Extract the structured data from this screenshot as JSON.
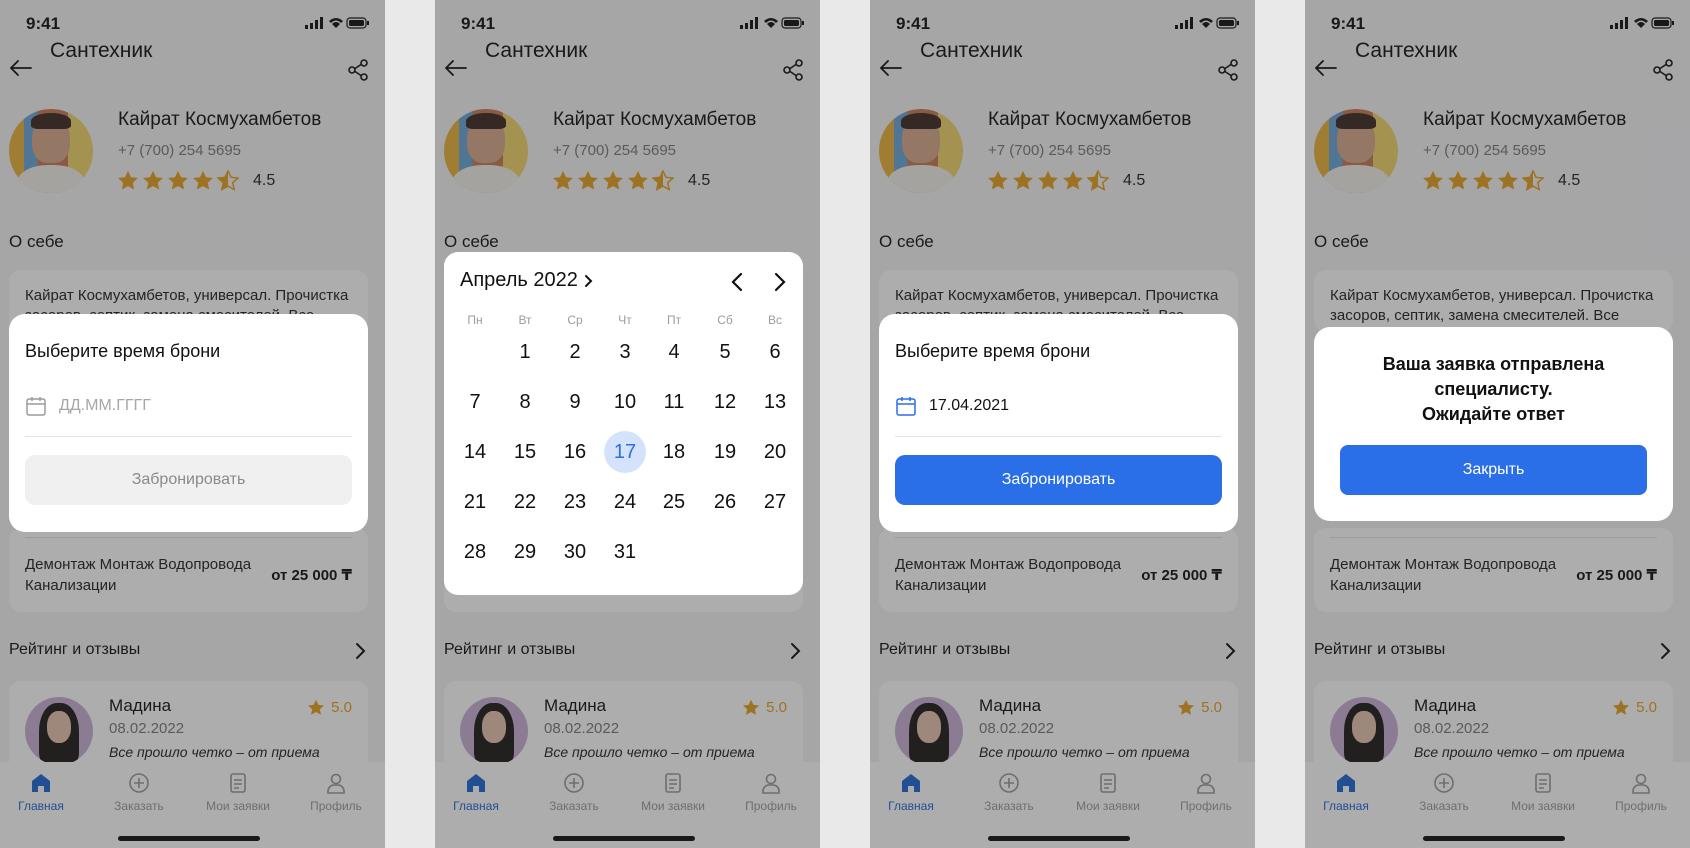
{
  "status_time": "9:41",
  "title": "Сантехник",
  "profile": {
    "name": "Кайрат Космухамбетов",
    "phone": "+7 (700) 254 5695",
    "rating": "4.5"
  },
  "about": {
    "heading": "О себе",
    "text": "Кайрат Космухамбетов, универсал. Прочистка засоров, септик, замена смесителей. Все"
  },
  "service": {
    "name": "Демонтаж Монтаж Водопровода Канализации",
    "price": "от 25 000 ₸"
  },
  "rating_heading": "Рейтинг и отзывы",
  "review": {
    "name": "Мадина",
    "date": "08.02.2022",
    "score": "5.0",
    "text": "Все прошло четко – от приема"
  },
  "tabs": [
    {
      "label": "Главная",
      "icon": "home-icon"
    },
    {
      "label": "Заказать",
      "icon": "plus-circle-icon"
    },
    {
      "label": "Мои заявки",
      "icon": "document-icon"
    },
    {
      "label": "Профиль",
      "icon": "user-icon"
    }
  ],
  "booking": {
    "title": "Выберите время брони",
    "placeholder": "ДД.ММ.ГГГГ",
    "filled_value": "17.04.2021",
    "button": "Забронировать"
  },
  "calendar": {
    "month": "Апрель 2022",
    "weekdays": [
      "Пн",
      "Вт",
      "Ср",
      "Чт",
      "Пт",
      "Сб",
      "Вс"
    ],
    "days": [
      "1",
      "2",
      "3",
      "4",
      "5",
      "6",
      "7",
      "8",
      "9",
      "10",
      "11",
      "12",
      "13",
      "14",
      "15",
      "16",
      "17",
      "18",
      "19",
      "20",
      "21",
      "22",
      "23",
      "24",
      "25",
      "26",
      "27",
      "28",
      "29",
      "30",
      "31"
    ],
    "first_weekday_index": 1,
    "selected": "17"
  },
  "confirmation": {
    "line1": "Ваша заявка отправлена",
    "line2": "специалисту.",
    "line3": "Ожидайте ответ",
    "button": "Закрыть"
  },
  "colors": {
    "accent": "#2a6fe8",
    "star": "#e6a020",
    "active_tab": "#1f66d6"
  }
}
